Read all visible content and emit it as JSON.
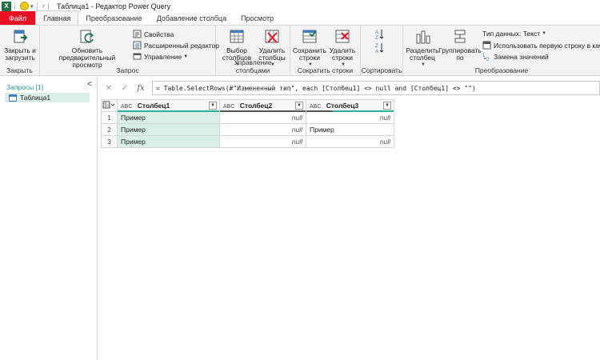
{
  "titlebar": {
    "app_letter": "X",
    "title": "Таблица1 - Редактор Power Query"
  },
  "tabs": [
    "Файл",
    "Главная",
    "Преобразование",
    "Добавление столбца",
    "Просмотр"
  ],
  "ribbon": {
    "close_group": {
      "label": "Закрыть",
      "close_load": "Закрыть и загрузить"
    },
    "query_group": {
      "label": "Запрос",
      "refresh_preview": "Обновить предварительный просмотр",
      "properties": "Свойства",
      "advanced_editor": "Расширенный редактор",
      "manage": "Управление"
    },
    "columns_group": {
      "label": "Управление столбцами",
      "choose_columns": "Выбор столбцов",
      "remove_columns": "Удалить столбцы"
    },
    "rows_group": {
      "label": "Сократить строки",
      "keep_rows": "Сохранить строки",
      "remove_rows": "Удалить строки"
    },
    "sort_group": {
      "label": "Сортировать"
    },
    "transform_group": {
      "label": "Преобразование",
      "split_column": "Разделить столбец",
      "group_by": "Группировать по",
      "data_type": "Тип данных: Текст",
      "use_first_row": "Использовать первую строку в качес",
      "replace_values": "Замена значений"
    }
  },
  "queries": {
    "header": "Запросы [1]",
    "collapse": "<",
    "items": [
      "Таблица1"
    ]
  },
  "formula": {
    "cancel": "✕",
    "confirm": "✓",
    "fx": "fx",
    "text": "= Table.SelectRows(#\"Измененный тип\", each [Столбец1] <> null and [Столбец1] <> \"\")"
  },
  "grid": {
    "type_tag": "ABC",
    "columns": [
      "Столбец1",
      "Столбец2",
      "Столбец3"
    ],
    "rows": [
      {
        "n": "1",
        "c1": "Пример",
        "c2": "null",
        "c3": "null"
      },
      {
        "n": "2",
        "c1": "Пример",
        "c2": "null",
        "c3": "Пример"
      },
      {
        "n": "3",
        "c1": "Пример",
        "c2": "null",
        "c3": "null"
      }
    ]
  },
  "colors": {
    "file_tab": "#e81123",
    "accent_teal": "#2bb29b",
    "selected_bg": "#d9efe6",
    "excel_green": "#1e7145"
  }
}
